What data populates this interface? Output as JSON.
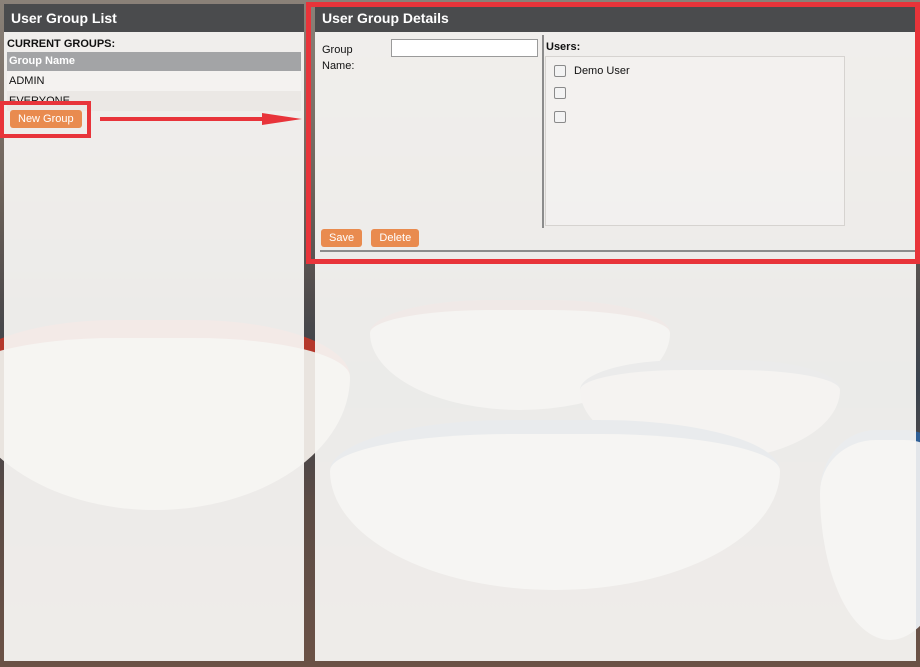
{
  "left_panel": {
    "title": "User Group List",
    "section_label": "CURRENT GROUPS:",
    "table_header": "Group Name",
    "groups": [
      "ADMIN",
      "EVERYONE"
    ],
    "new_group_label": "New Group"
  },
  "right_panel": {
    "title": "User Group Details",
    "group_name_label": "Group Name:",
    "group_name_value": "",
    "users_label": "Users:",
    "users": [
      {
        "name": "Demo User",
        "checked": false
      },
      {
        "name": "",
        "checked": false
      },
      {
        "name": "",
        "checked": false
      }
    ],
    "save_label": "Save",
    "delete_label": "Delete"
  },
  "colors": {
    "header_bg": "#4a4b4d",
    "accent_orange": "#e98b4f",
    "highlight_red": "#e8343a"
  }
}
